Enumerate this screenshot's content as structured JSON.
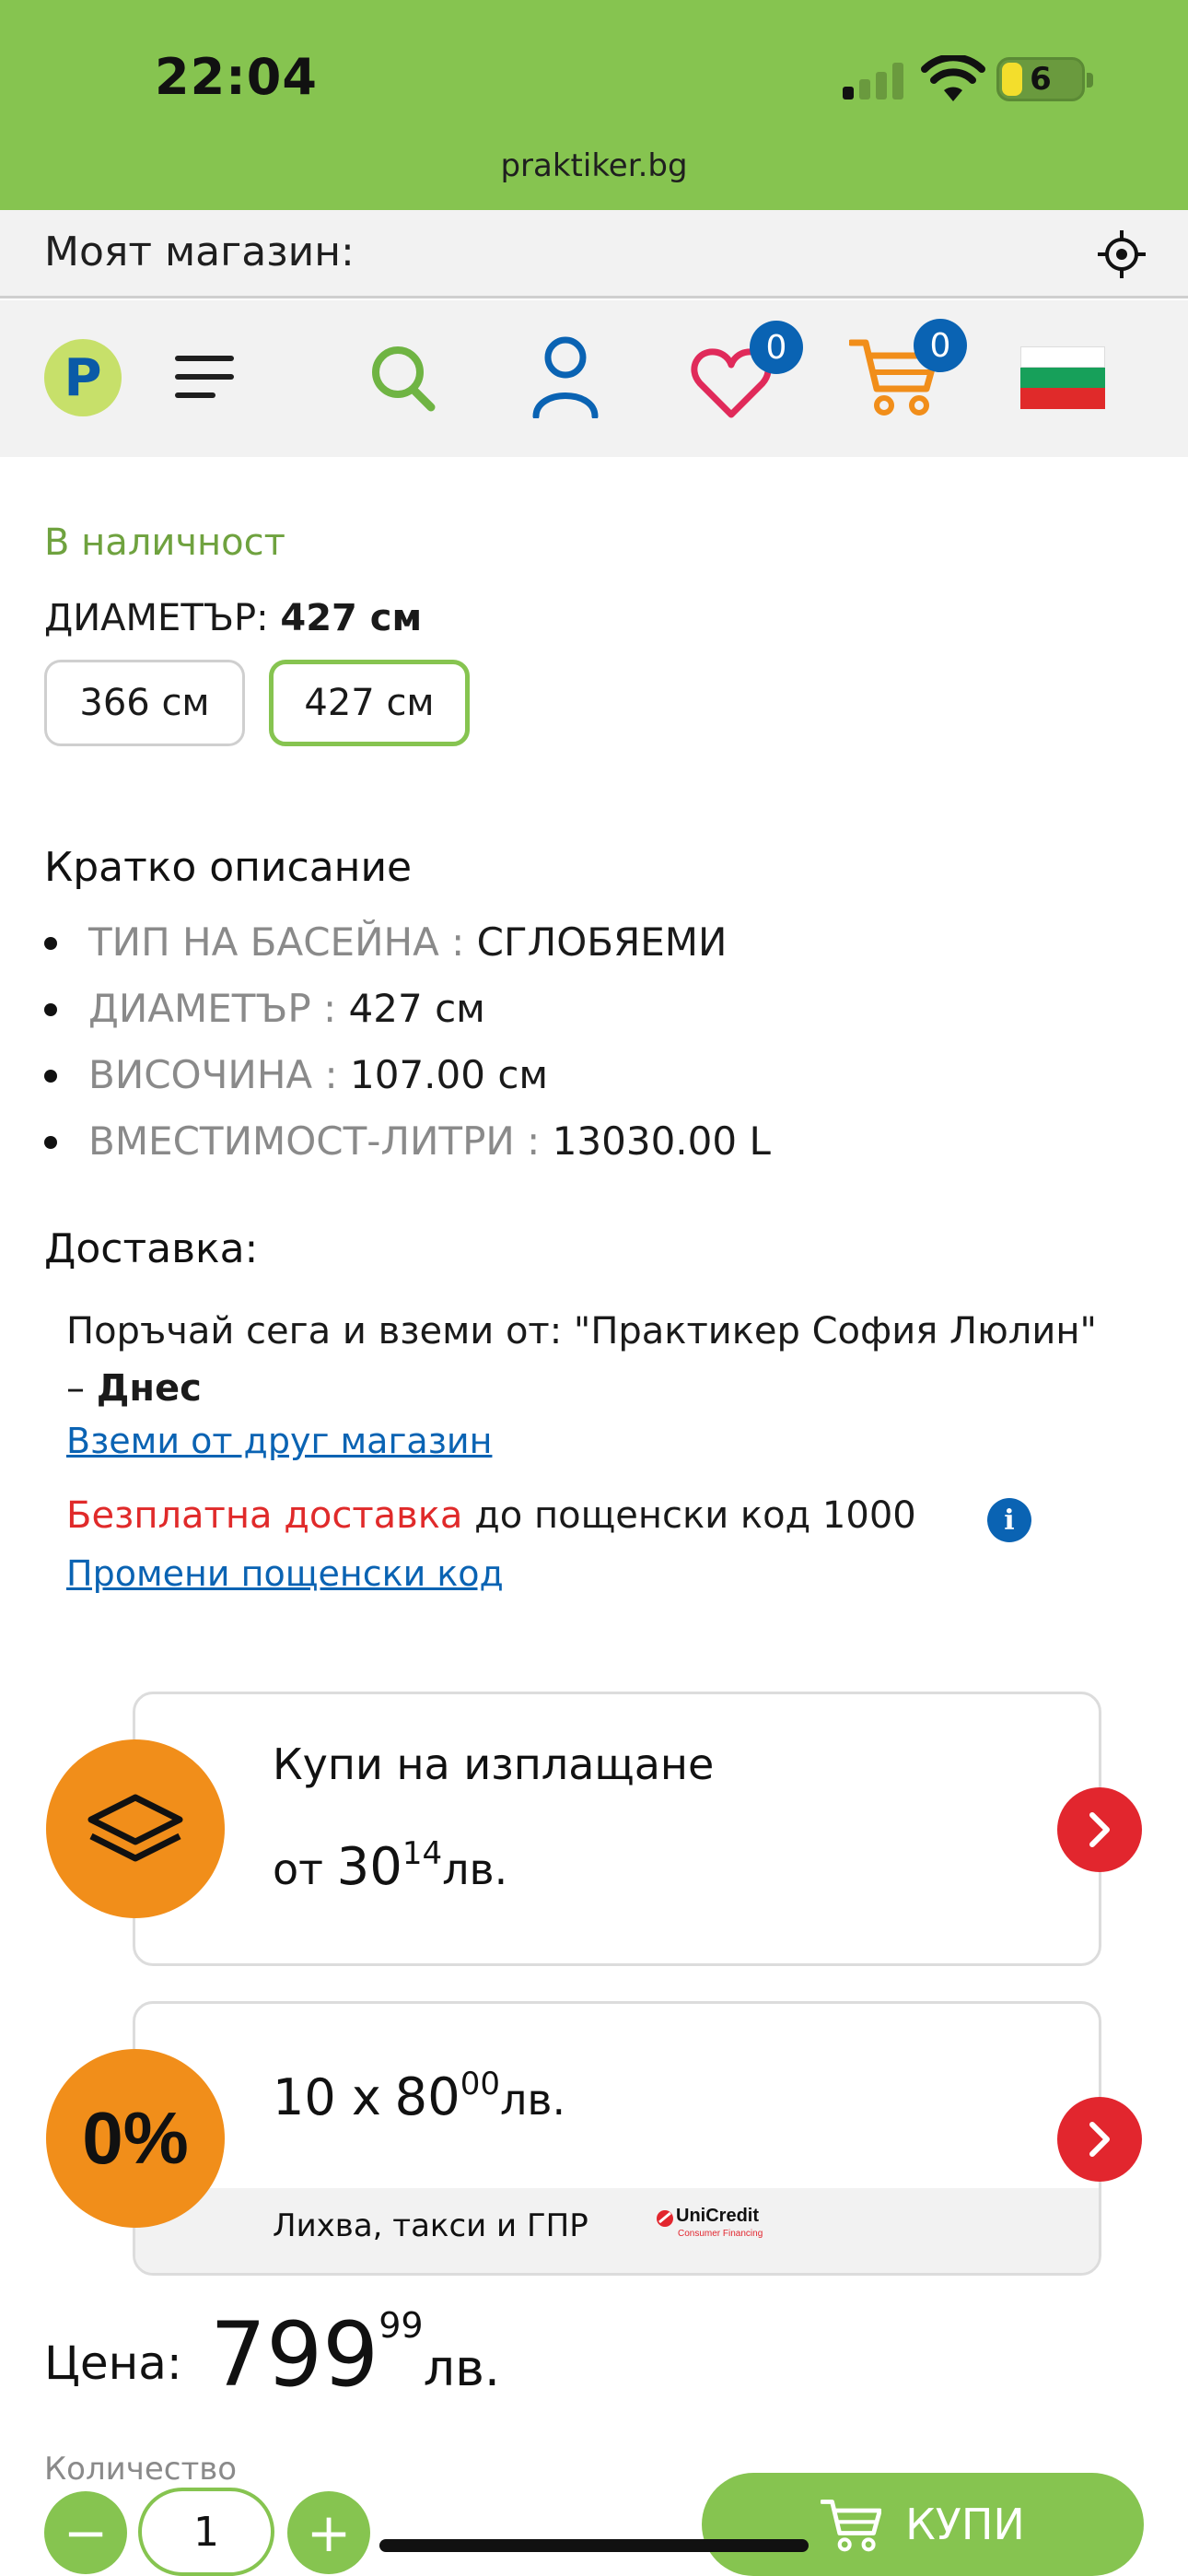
{
  "status": {
    "time": "22:04",
    "battery": "6"
  },
  "browser": {
    "url": "praktiker.bg"
  },
  "store": {
    "label": "Моят магазин:"
  },
  "header": {
    "logo": "P",
    "wishlist_count": "0",
    "cart_count": "0"
  },
  "product": {
    "availability": "В наличност",
    "diameter_label": "ДИАМЕТЪР:",
    "diameter_selected": "427 см",
    "options": [
      "366 см",
      "427 см"
    ],
    "selected_option": "427 см"
  },
  "description": {
    "title": "Кратко описание",
    "items": [
      {
        "key": "ТИП НА БАСЕЙНА :",
        "value": "СГЛОБЯЕМИ"
      },
      {
        "key": "ДИАМЕТЪР :",
        "value": "427 см"
      },
      {
        "key": "ВИСОЧИНА :",
        "value": "107.00 см"
      },
      {
        "key": "ВМЕСТИМОСТ-ЛИТРИ :",
        "value": "13030.00 L"
      }
    ]
  },
  "delivery": {
    "title": "Доставка:",
    "pickup_text": "Поръчай сега и вземи от: \"Практикер София Люлин\" –",
    "pickup_when": "Днес",
    "other_store_link": "Вземи от друг магазин",
    "free_label": "Безплатна доставка",
    "free_rest": "до пощенски код 1000",
    "info_icon": "i",
    "change_postcode_link": "Промени пощенски код"
  },
  "installment": {
    "title": "Купи на изплащане",
    "from": "от",
    "amount_int": "30",
    "amount_dec": "14",
    "currency": "лв."
  },
  "zero_interest": {
    "badge": "0%",
    "count": "10 x",
    "amount_int": "80",
    "amount_dec": "00",
    "currency": "лв.",
    "note": "Лихва, такси и ГПР",
    "partner": "UniCredit",
    "partner_sub": "Consumer Financing"
  },
  "price": {
    "label": "Цена:",
    "int": "799",
    "dec": "99",
    "currency": "лв."
  },
  "quantity": {
    "label": "Количество",
    "value": "1",
    "minus": "−",
    "plus": "+"
  },
  "buy": {
    "label": "КУПИ"
  },
  "colors": {
    "brand_green": "#86c450",
    "orange": "#f18e1a",
    "red": "#e2262e",
    "blue": "#0a63b3"
  }
}
